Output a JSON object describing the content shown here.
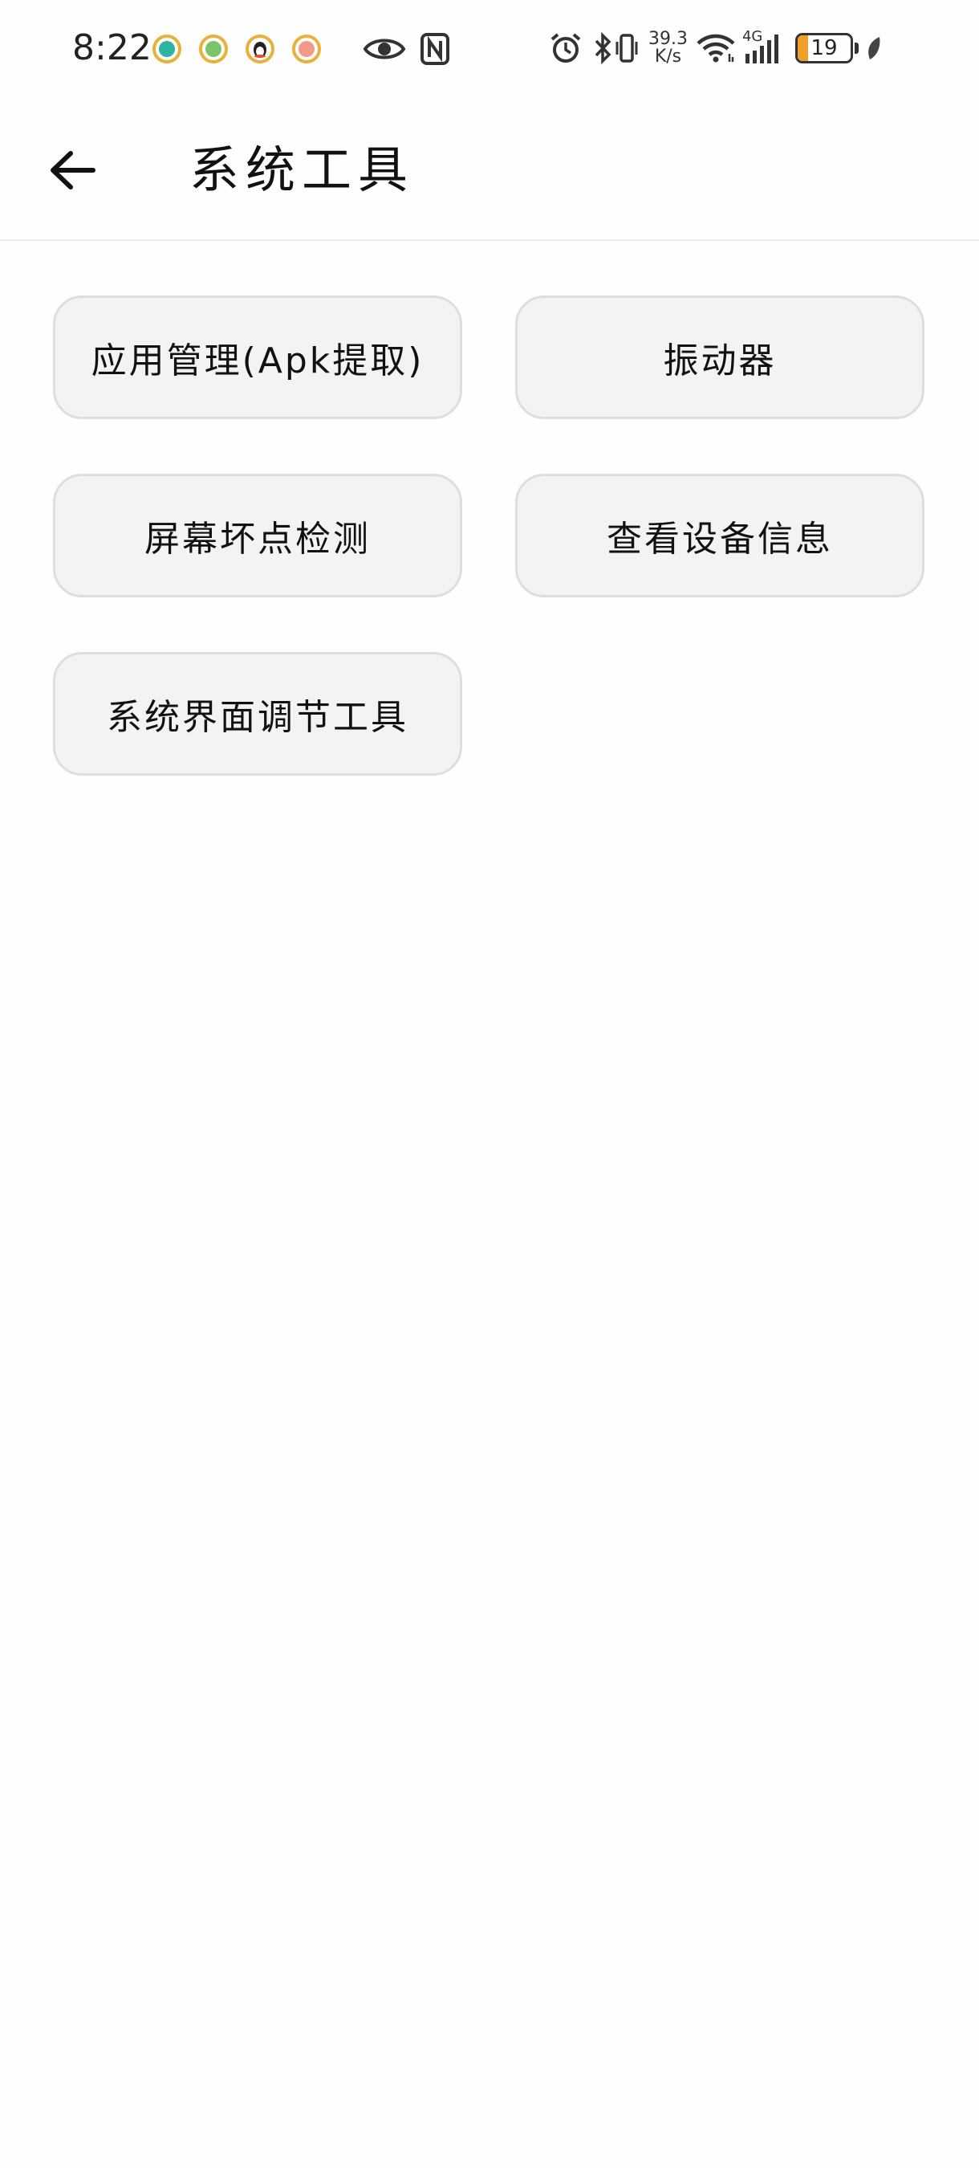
{
  "status_bar": {
    "time": "8:22",
    "net_speed_value": "39.3",
    "net_speed_unit": "K/s",
    "network_type": "4G",
    "battery_level": "19",
    "battery_fraction": 0.19,
    "notification_icons": [
      "green-app-icon",
      "green-app-icon",
      "qq-penguin-icon",
      "hand-app-icon"
    ],
    "system_icons": [
      "eye-comfort-icon",
      "nfc-icon",
      "alarm-icon",
      "bluetooth-icon",
      "vibrate-icon",
      "wifi-icon",
      "signal-icon",
      "battery-icon",
      "battery-saver-leaf-icon"
    ]
  },
  "app_bar": {
    "back_icon": "arrow-left-icon",
    "title": "系统工具"
  },
  "tools": [
    {
      "name": "apk-extract-button",
      "label": "应用管理(Apk提取)"
    },
    {
      "name": "vibrator-button",
      "label": "振动器"
    },
    {
      "name": "dead-pixel-test-button",
      "label": "屏幕坏点检测"
    },
    {
      "name": "device-info-button",
      "label": "查看设备信息"
    },
    {
      "name": "system-ui-tuner-button",
      "label": "系统界面调节工具"
    }
  ],
  "colors": {
    "button_bg": "#f3f3f3",
    "button_border": "#dedede",
    "battery_fill": "#f0a02a",
    "text": "#111111"
  }
}
